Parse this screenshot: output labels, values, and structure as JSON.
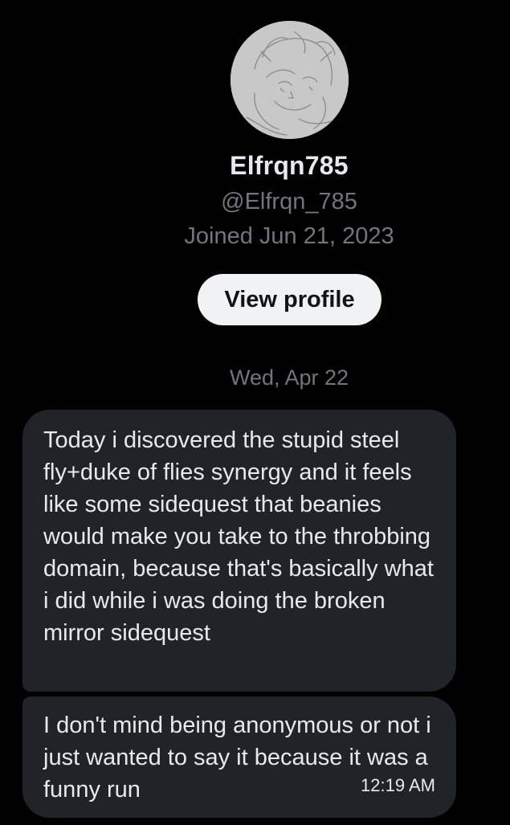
{
  "profile": {
    "display_name": "Elfrqn785",
    "handle": "@Elfrqn_785",
    "joined": "Joined Jun 21, 2023",
    "view_profile_label": "View profile"
  },
  "conversation": {
    "date_separator": "Wed, Apr 22",
    "messages": [
      {
        "text": "Today i discovered the stupid steel fly+duke of flies synergy and it feels like some sidequest that beanies would make you take to the throbbing domain, because that's basically what i did while i was doing the broken mirror sidequest"
      },
      {
        "text": "I don't mind being anonymous or not i just wanted to say it because it was a funny run",
        "time": "12:19 AM"
      }
    ]
  },
  "colors": {
    "background": "#000000",
    "bubble": "#202327",
    "primary_text": "#e7e9ea",
    "secondary_text": "#71767b",
    "button_bg": "#eff3f4",
    "button_text": "#0f1419"
  },
  "icons": {
    "avatar": "sketched-character-avatar"
  }
}
